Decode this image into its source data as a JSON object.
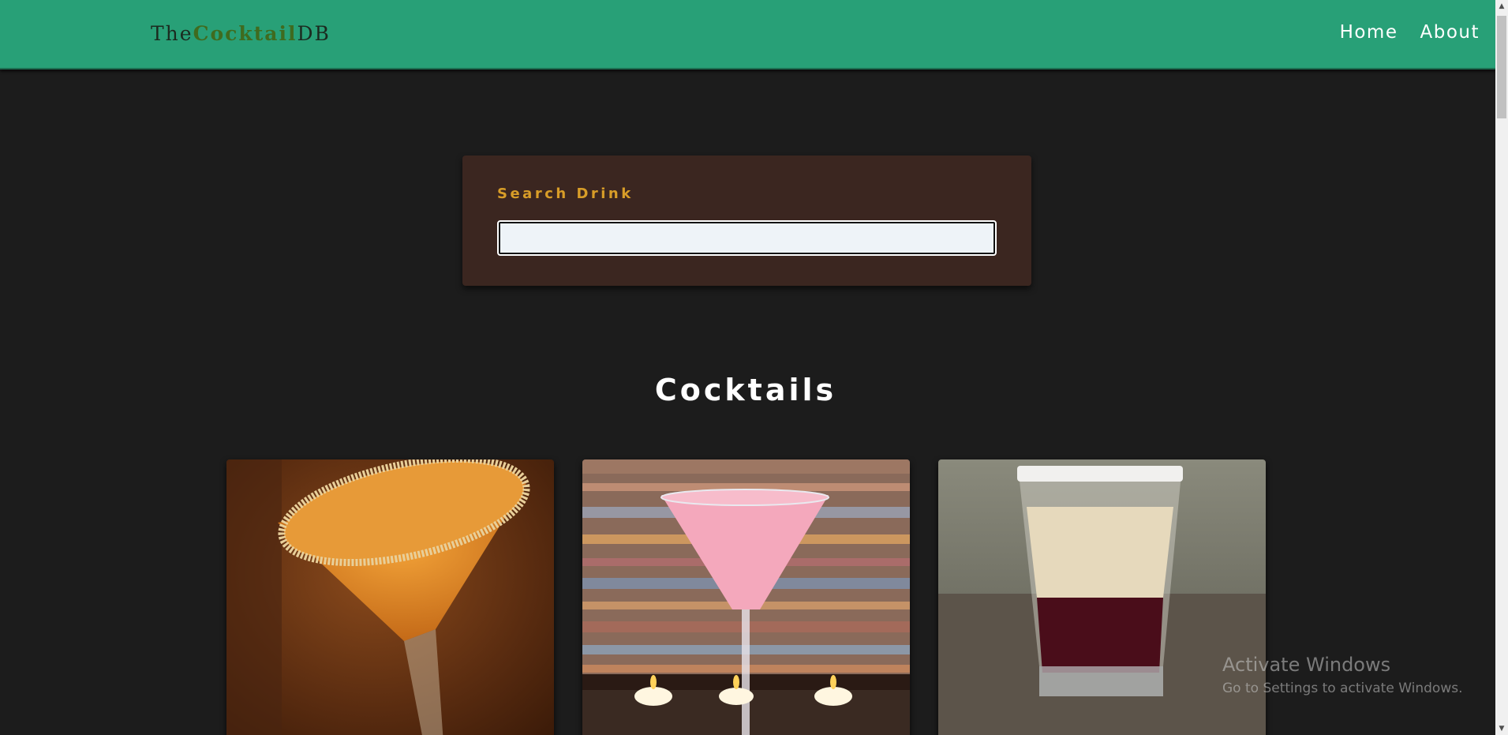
{
  "nav": {
    "logo_prefix": "The",
    "logo_accent": "Cocktail",
    "logo_suffix": "DB",
    "links": [
      {
        "label": "Home"
      },
      {
        "label": "About"
      }
    ]
  },
  "search": {
    "label": "Search Drink",
    "value": ""
  },
  "section_title": "Cocktails",
  "cards": [
    {
      "image": "cocktail-photo"
    },
    {
      "image": "cocktail-photo"
    },
    {
      "image": "cocktail-photo"
    }
  ],
  "watermark": {
    "title": "Activate Windows",
    "subtitle": "Go to Settings to activate Windows."
  },
  "colors": {
    "navbar": "#28a077",
    "page_bg": "#1c1c1c",
    "search_card_bg": "#3b2620",
    "search_label": "#d89d28",
    "logo_accent": "#3f6b1f"
  },
  "scrollbar": {
    "up_icon": "scroll-up-arrow-icon",
    "down_icon": "scroll-down-arrow-icon"
  }
}
